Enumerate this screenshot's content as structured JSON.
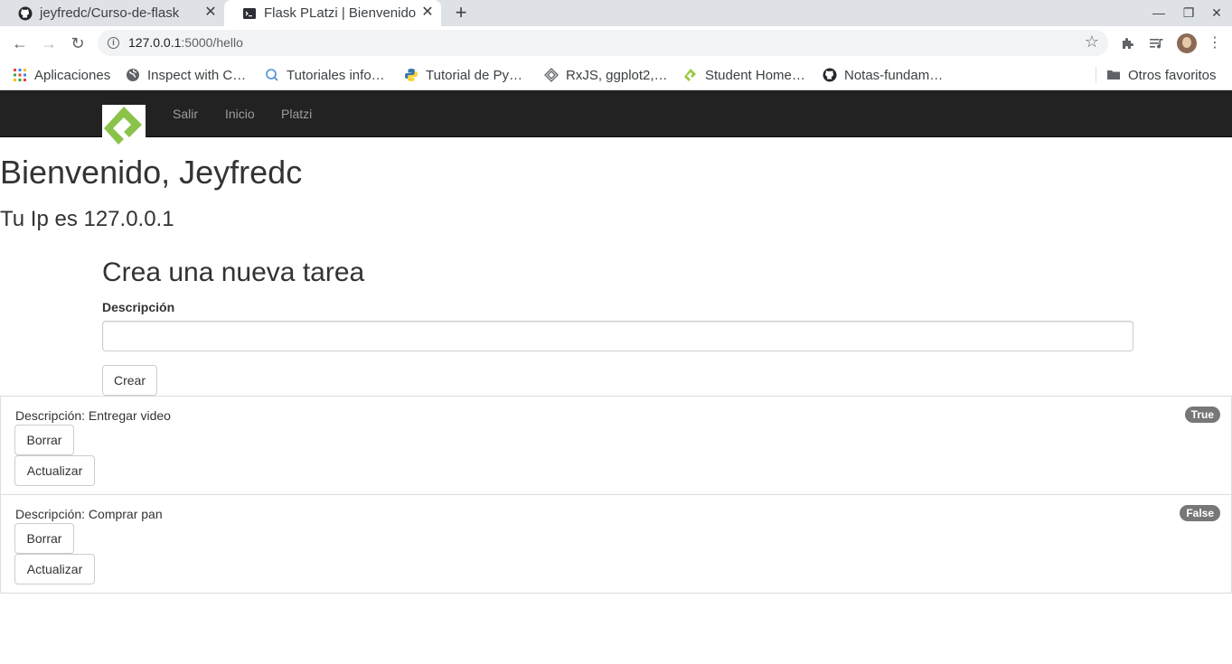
{
  "browser": {
    "tabs": [
      {
        "title": "jeyfredc/Curso-de-flask",
        "active": false
      },
      {
        "title": "Flask PLatzi | Bienvenido",
        "active": true
      }
    ],
    "new_tab_label": "+",
    "url_host": "127.0.0.1",
    "url_path": ":5000/hello",
    "bookmarks": [
      {
        "label": "Aplicaciones",
        "icon": "apps-grid-icon"
      },
      {
        "label": "Inspect with C…",
        "icon": "globe-icon"
      },
      {
        "label": "Tutoriales info…",
        "icon": "search-q-icon"
      },
      {
        "label": "Tutorial de Py…",
        "icon": "python-icon"
      },
      {
        "label": "RxJS, ggplot2,…",
        "icon": "diamond-icon"
      },
      {
        "label": "Student Home…",
        "icon": "platzi-icon"
      },
      {
        "label": "Notas-fundam…",
        "icon": "github-icon"
      }
    ],
    "other_bookmarks": "Otros favoritos",
    "colors": {
      "chrome_bg": "#dee1e6",
      "omnibox_bg": "#f1f3f4"
    }
  },
  "navbar": {
    "links": [
      "Salir",
      "Inicio",
      "Platzi"
    ],
    "colors": {
      "background": "#222222",
      "link": "#9d9d9d",
      "logo_green": "#8bc34a"
    }
  },
  "page": {
    "welcome": "Bienvenido, Jeyfredc",
    "ip_text": "Tu Ip es 127.0.0.1",
    "form_title": "Crea una nueva tarea",
    "description_label": "Descripción",
    "description_value": "",
    "submit_label": "Crear"
  },
  "todos": [
    {
      "description": "Descripción: Entregar video",
      "done": "True",
      "delete_label": "Borrar",
      "update_label": "Actualizar"
    },
    {
      "description": "Descripción: Comprar pan",
      "done": "False",
      "delete_label": "Borrar",
      "update_label": "Actualizar"
    }
  ]
}
